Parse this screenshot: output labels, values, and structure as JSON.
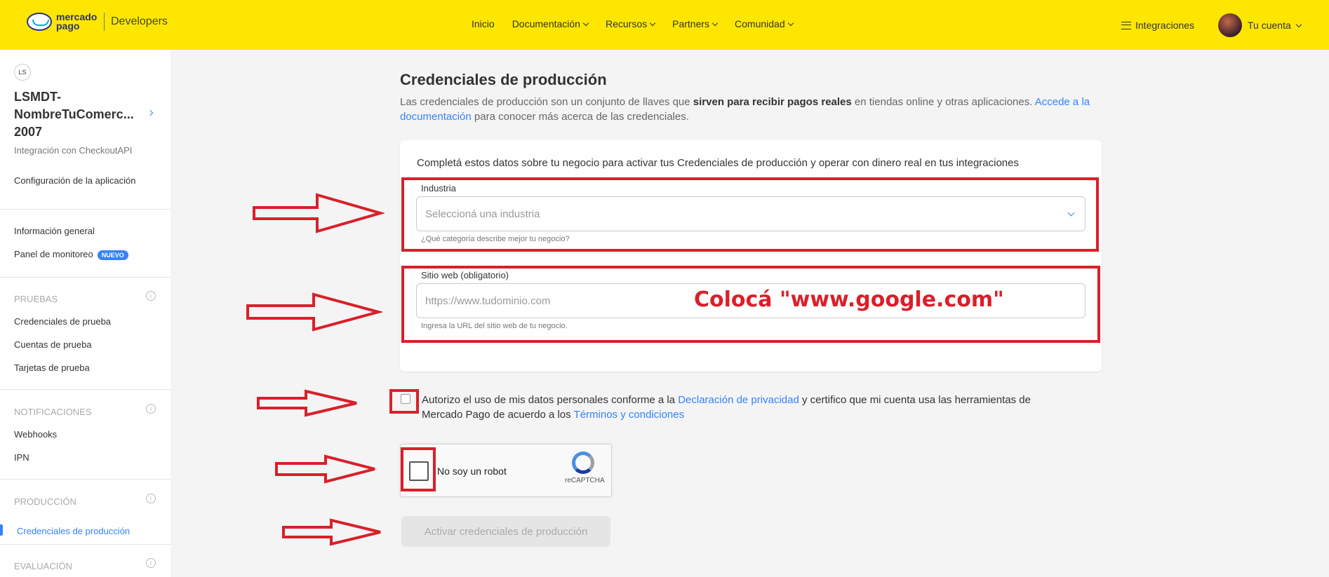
{
  "header": {
    "logo_text": "mercado pago",
    "logo_suffix": "Developers",
    "nav": [
      {
        "label": "Inicio",
        "dropdown": false
      },
      {
        "label": "Documentación",
        "dropdown": true
      },
      {
        "label": "Recursos",
        "dropdown": true
      },
      {
        "label": "Partners",
        "dropdown": true
      },
      {
        "label": "Comunidad",
        "dropdown": true
      }
    ],
    "integrations_label": "Integraciones",
    "account_label": "Tu cuenta"
  },
  "sidebar": {
    "badge": "LS",
    "app_name": "LSMDT-NombreTuComerc... 2007",
    "app_subtitle": "Integración con CheckoutAPI",
    "app_config": "Configuración de la aplicación",
    "general": "Información general",
    "monitor": "Panel de monitoreo",
    "monitor_badge": "NUEVO",
    "sections": {
      "pruebas": "PRUEBAS",
      "notificaciones": "NOTIFICACIONES",
      "produccion": "PRODUCCIÓN",
      "evaluacion": "EVALUACIÓN"
    },
    "pruebas_items": [
      "Credenciales de prueba",
      "Cuentas de prueba",
      "Tarjetas de prueba"
    ],
    "notif_items": [
      "Webhooks",
      "IPN"
    ],
    "prod_item": "Credenciales de producción"
  },
  "main": {
    "title": "Credenciales de producción",
    "desc_1": "Las credenciales de producción son un conjunto de llaves que ",
    "desc_bold": "sirven para recibir pagos reales",
    "desc_2": " en tiendas online y otras aplicaciones. ",
    "desc_link": "Accede a la documentación",
    "desc_3": " para conocer más acerca de las credenciales.",
    "card_intro": "Completá estos datos sobre tu negocio para activar tus Credenciales de producción y operar con dinero real en tus integraciones",
    "industry_label": "Industria",
    "industry_placeholder": "Seleccioná una industria",
    "industry_hint": "¿Qué categoría describe mejor tu negocio?",
    "website_label": "Sitio web (obligatorio)",
    "website_placeholder": "https://www.tudominio.com",
    "website_hint": "Ingresa la URL del sitio web de tu negocio.",
    "consent_1": "Autorizo el uso de mis datos personales conforme a la ",
    "consent_link1": "Declaración de privacidad",
    "consent_2": " y certifico que mi cuenta usa las herramientas de Mercado Pago de acuerdo a los ",
    "consent_link2": "Términos y condiciones",
    "recaptcha_label": "No soy un robot",
    "recaptcha_brand": "reCAPTCHA",
    "submit": "Activar credenciales de producción"
  },
  "annotation": {
    "note": "Colocá \"www.google.com\"",
    "color": "#d9202a"
  },
  "colors": {
    "header_bg": "#ffe600",
    "accent": "#3483fa"
  }
}
